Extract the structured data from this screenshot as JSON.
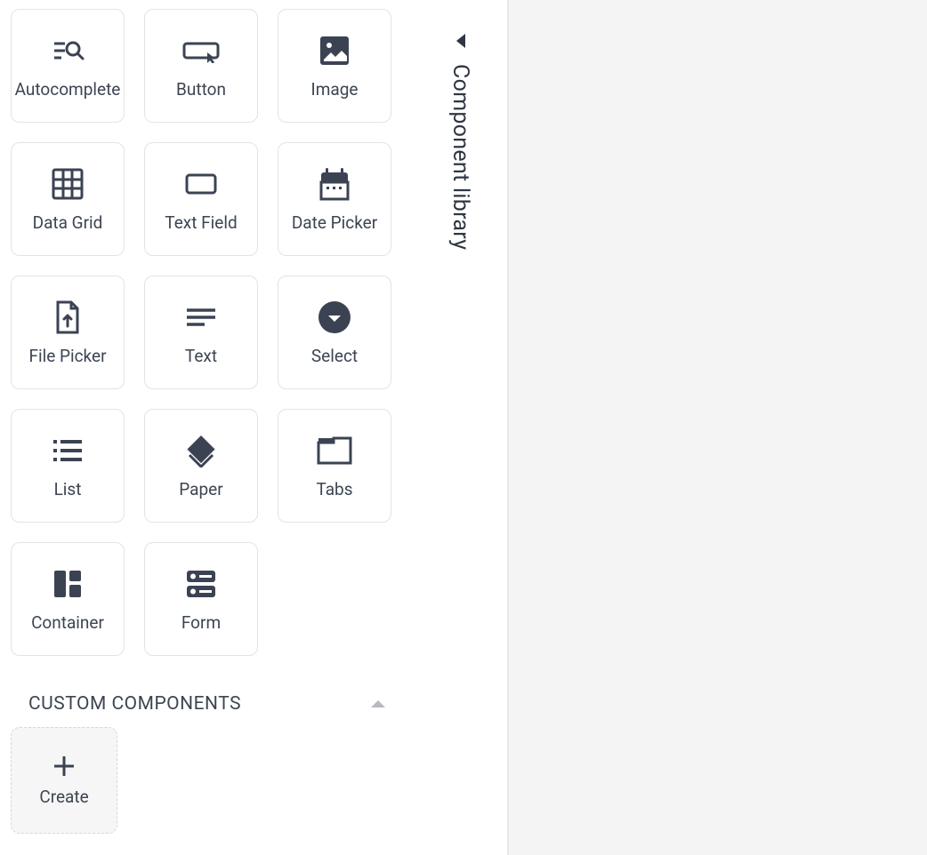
{
  "sidebar_title": "Component library",
  "components": [
    {
      "label": "Autocomplete",
      "icon": "autocomplete-icon"
    },
    {
      "label": "Button",
      "icon": "button-icon"
    },
    {
      "label": "Image",
      "icon": "image-icon"
    },
    {
      "label": "Data Grid",
      "icon": "datagrid-icon"
    },
    {
      "label": "Text Field",
      "icon": "textfield-icon"
    },
    {
      "label": "Date Picker",
      "icon": "datepicker-icon"
    },
    {
      "label": "File Picker",
      "icon": "filepicker-icon"
    },
    {
      "label": "Text",
      "icon": "text-icon"
    },
    {
      "label": "Select",
      "icon": "select-icon"
    },
    {
      "label": "List",
      "icon": "list-icon"
    },
    {
      "label": "Paper",
      "icon": "paper-icon"
    },
    {
      "label": "Tabs",
      "icon": "tabs-icon"
    },
    {
      "label": "Container",
      "icon": "container-icon"
    },
    {
      "label": "Form",
      "icon": "form-icon"
    }
  ],
  "custom_section": {
    "title": "CUSTOM COMPONENTS",
    "create_label": "Create"
  }
}
